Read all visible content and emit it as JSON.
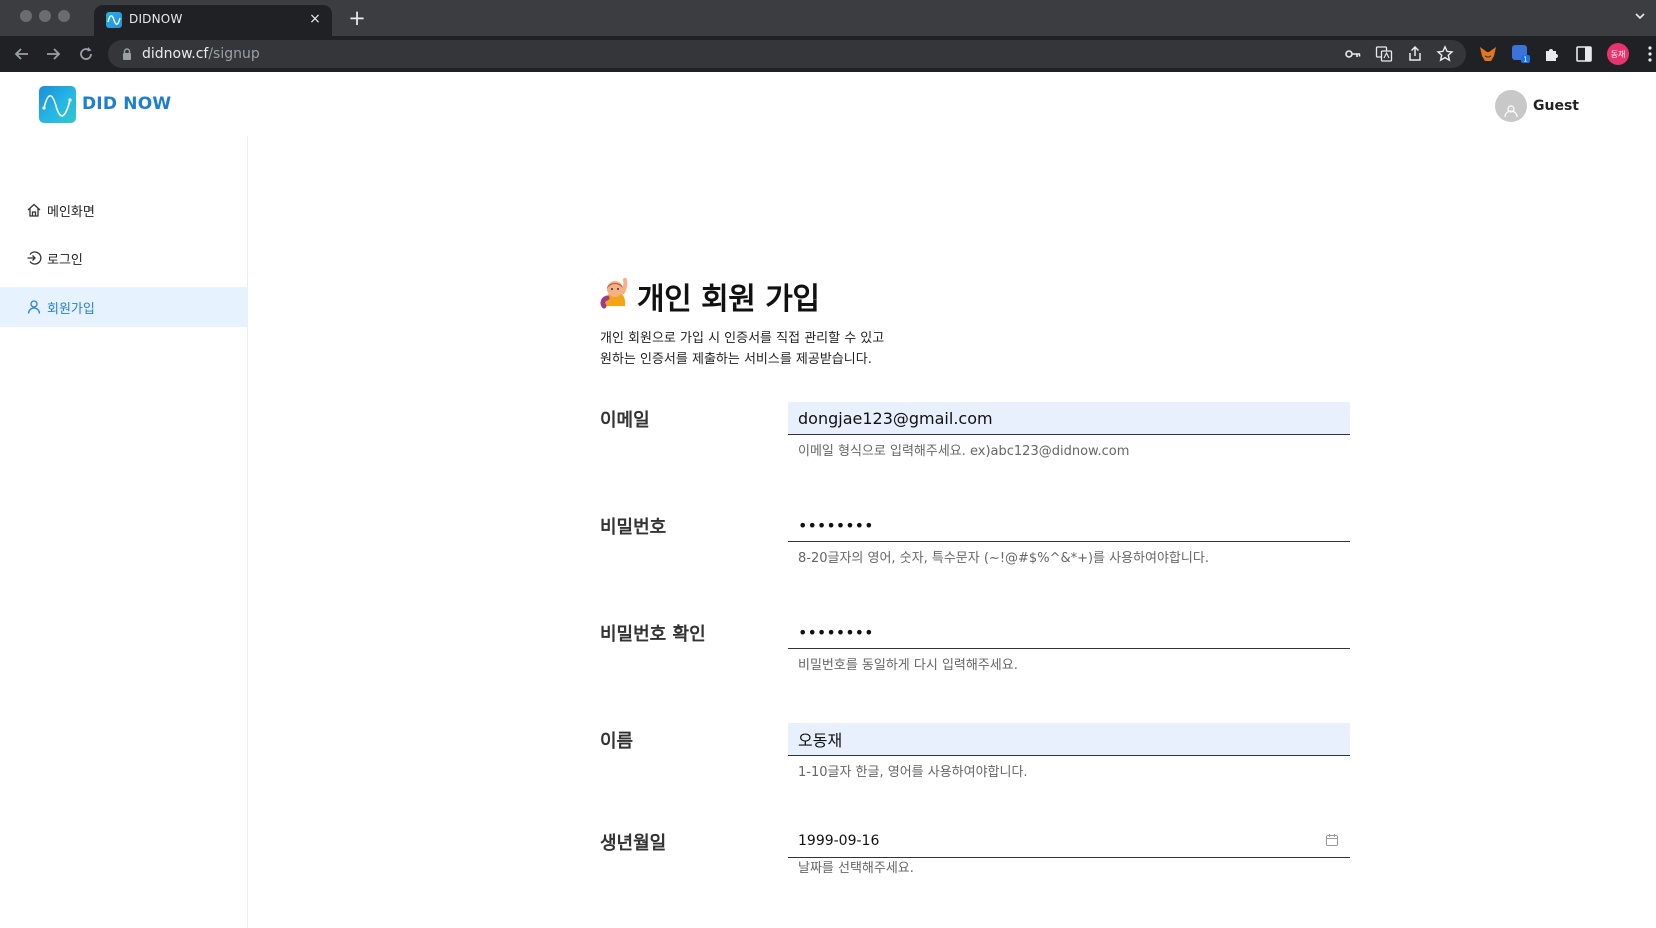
{
  "browser": {
    "tab_title": "DIDNOW",
    "tab_close": "×",
    "new_tab": "+",
    "url_host": "didnow.cf",
    "url_path": "/signup",
    "profile_initials": "동재",
    "extension_badge": "1"
  },
  "header": {
    "logo_text": "DID NOW",
    "user_name": "Guest"
  },
  "sidebar": {
    "items": [
      {
        "label": "메인화면",
        "icon": "home-icon"
      },
      {
        "label": "로그인",
        "icon": "login-icon"
      },
      {
        "label": "회원가입",
        "icon": "user-icon",
        "active": true
      }
    ]
  },
  "page": {
    "title_emoji": "person-raising-hand",
    "title": "개인 회원 가입",
    "desc_line1": "개인 회원으로 가입 시 인증서를 직접 관리할 수 있고",
    "desc_line2": "원하는 인증서를 제출하는 서비스를 제공받습니다."
  },
  "form": {
    "email": {
      "label": "이메일",
      "value": "dongjae123@gmail.com",
      "help": "이메일 형식으로 입력해주세요. ex)abc123@didnow.com"
    },
    "password": {
      "label": "비밀번호",
      "value": "••••••••",
      "help": "8-20글자의 영어, 숫자, 특수문자 (~!@#$%^&*+)를 사용하여야합니다."
    },
    "password_confirm": {
      "label": "비밀번호 확인",
      "value": "••••••••",
      "help": "비밀번호를 동일하게 다시 입력해주세요."
    },
    "name": {
      "label": "이름",
      "value": "오동재",
      "help": "1-10글자 한글, 영어를 사용하여야합니다."
    },
    "birth": {
      "label": "생년월일",
      "value": "1999-09-16",
      "help": "날짜를 선택해주세요."
    }
  },
  "colors": {
    "accent": "#2b7fe0",
    "sidebar_active_bg": "#e6f2fd",
    "input_filled_bg": "#e8f0fe",
    "chrome_dark": "#202124"
  }
}
